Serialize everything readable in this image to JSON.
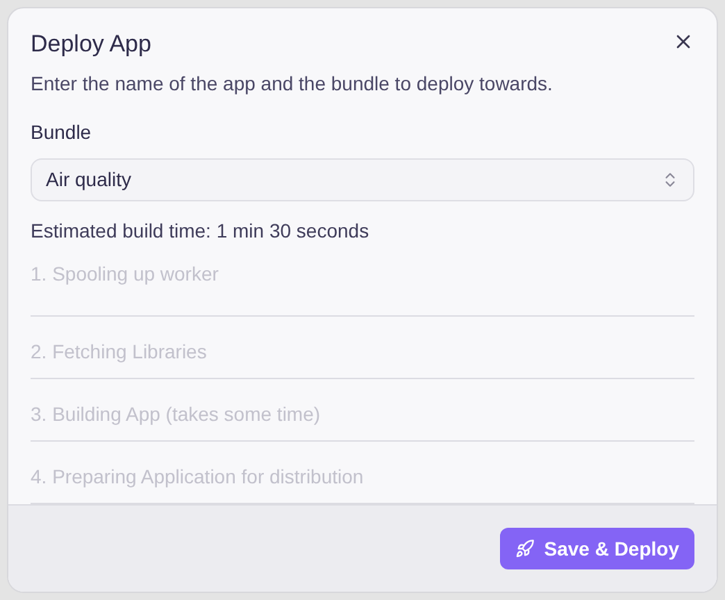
{
  "dialog": {
    "title": "Deploy App",
    "description": "Enter the name of the app and the bundle to deploy towards."
  },
  "bundle": {
    "label": "Bundle",
    "value": "Air quality"
  },
  "estimate": "Estimated build time: 1 min 30 seconds",
  "steps": [
    {
      "label": "1. Spooling up worker",
      "active": false
    },
    {
      "label": "2. Fetching Libraries",
      "active": false
    },
    {
      "label": "3. Building App (takes some time)",
      "active": false
    },
    {
      "label": "4. Preparing Application for distribution",
      "active": false
    }
  ],
  "footer": {
    "button": "Save & Deploy"
  }
}
